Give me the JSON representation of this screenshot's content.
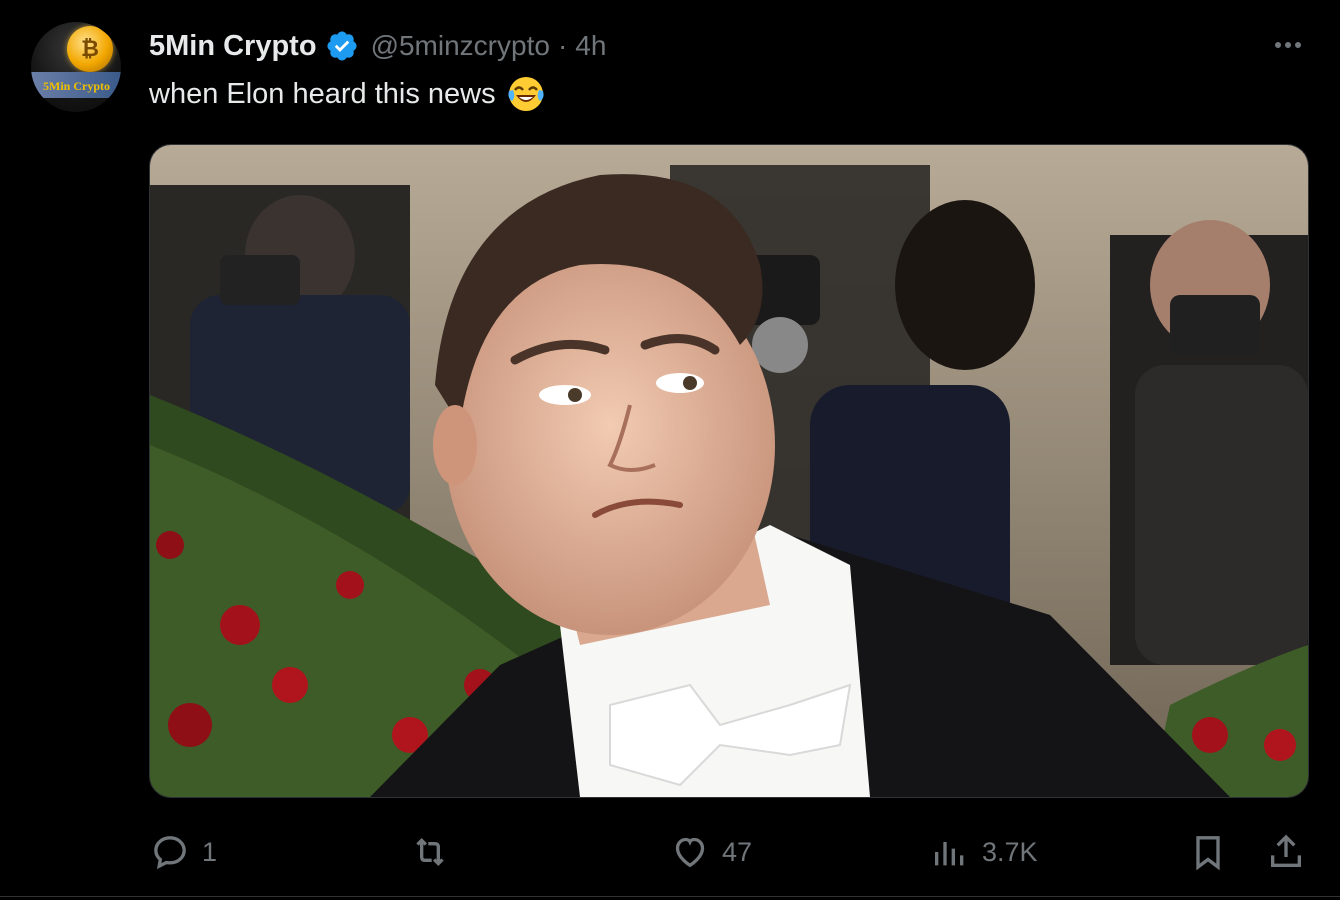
{
  "tweet": {
    "author_name": "5Min Crypto",
    "handle": "@5minzcrypto",
    "separator": "·",
    "time": "4h",
    "text": "when Elon heard this news",
    "emoji_icon": "face-with-tears-of-joy",
    "avatar_text": "5Min Crypto",
    "media_description_icon": "photo-man-in-tuxedo"
  },
  "actions": {
    "reply_count": "1",
    "repost_count": "",
    "like_count": "47",
    "views_count": "3.7K"
  },
  "colors": {
    "background": "#000000",
    "text": "#e7e9ea",
    "muted": "#71767b",
    "verified": "#1d9bf0",
    "border": "#2f3336"
  }
}
